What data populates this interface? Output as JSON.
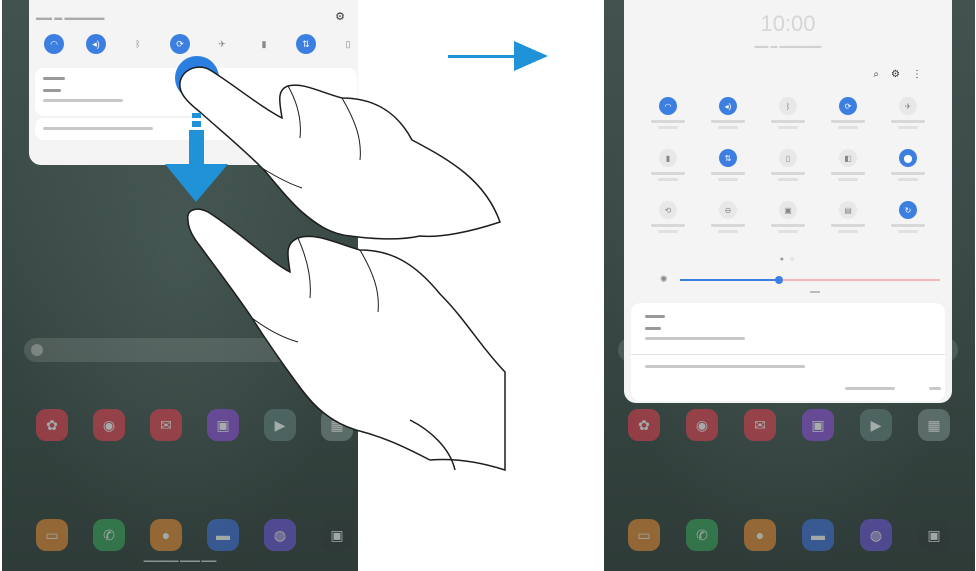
{
  "colors": {
    "accent": "#3d7fe0",
    "arrow": "#1f92d8"
  },
  "left_screen": {
    "quick_panel": {
      "settings_icon": "gear-icon",
      "toggles": [
        "wifi-icon",
        "sound-icon",
        "bluetooth-icon",
        "auto-rotate-icon",
        "airplane-icon",
        "flashlight-icon",
        "mobile-data-icon",
        "blue-light-icon"
      ]
    },
    "apps_row1": [
      "flower-icon",
      "camera-icon",
      "mail-icon",
      "store-icon",
      "play-icon",
      "apps-folder-icon"
    ],
    "apps_row2": [
      "calendar-icon",
      "phone-icon",
      "contacts-icon",
      "messages-icon",
      "internet-icon",
      "calendar-date-icon"
    ],
    "emergency_text": ""
  },
  "right_screen": {
    "clock": "10:00",
    "top_icons": [
      "search-icon",
      "gear-icon",
      "more-icon"
    ],
    "tiles": [
      {
        "icon": "wifi-icon",
        "on": true
      },
      {
        "icon": "sound-icon",
        "on": true
      },
      {
        "icon": "bluetooth-icon",
        "on": false
      },
      {
        "icon": "auto-rotate-icon",
        "on": true
      },
      {
        "icon": "airplane-icon",
        "on": false
      },
      {
        "icon": "flashlight-icon",
        "on": false
      },
      {
        "icon": "mobile-data-icon",
        "on": true
      },
      {
        "icon": "blue-light-icon",
        "on": false
      },
      {
        "icon": "screen-recorder-icon",
        "on": false
      },
      {
        "icon": "location-icon",
        "on": true
      },
      {
        "icon": "smart-view-icon",
        "on": false
      },
      {
        "icon": "do-not-disturb-icon",
        "on": false
      },
      {
        "icon": "secure-folder-icon",
        "on": false
      },
      {
        "icon": "tablet-icon",
        "on": false
      },
      {
        "icon": "sync-icon",
        "on": true
      }
    ],
    "brightness_level": 0.38,
    "apps_row1": [
      "flower-icon",
      "camera-icon",
      "mail-icon",
      "store-icon",
      "play-icon",
      "apps-folder-icon"
    ],
    "apps_row2": [
      "calendar-icon",
      "phone-icon",
      "contacts-icon",
      "messages-icon",
      "internet-icon",
      "calendar-date-icon"
    ]
  },
  "transition_arrow": "arrow-right-icon"
}
